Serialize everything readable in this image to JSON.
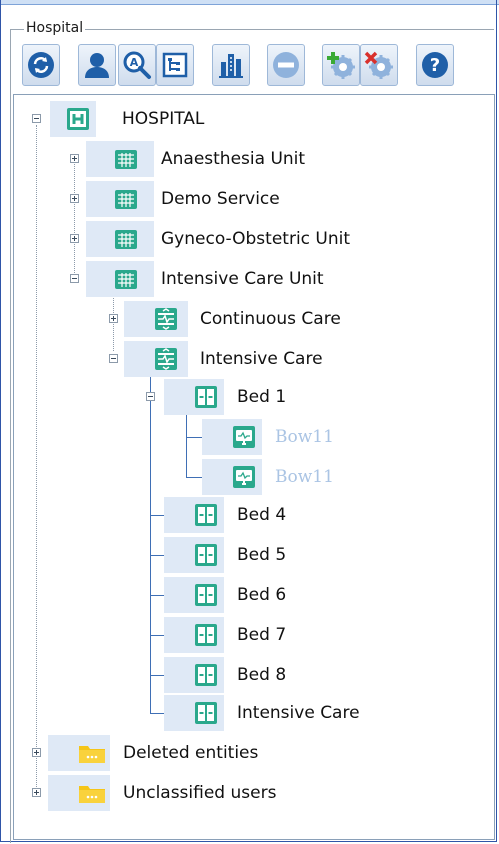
{
  "panel": {
    "title": "Hospital"
  },
  "toolbar": {
    "buttons": [
      {
        "name": "refresh-icon"
      },
      {
        "name": "user-icon"
      },
      {
        "name": "search-icon"
      },
      {
        "name": "hierarchy-icon"
      },
      {
        "name": "building-icon"
      },
      {
        "name": "remove-icon"
      },
      {
        "name": "add-settings-icon"
      },
      {
        "name": "delete-settings-icon"
      },
      {
        "name": "help-icon"
      }
    ]
  },
  "tree": {
    "root": "HOSPITAL",
    "units": {
      "anaesthesia": "Anaesthesia Unit",
      "demo": "Demo Service",
      "gyneco": "Gyneco-Obstetric Unit",
      "icu": "Intensive Care Unit"
    },
    "services": {
      "continuous": "Continuous Care",
      "intensive": "Intensive Care"
    },
    "beds": {
      "bed1": "Bed 1",
      "bed4": "Bed 4",
      "bed5": "Bed 5",
      "bed6": "Bed 6",
      "bed7": "Bed 7",
      "bed8": "Bed 8",
      "intensive": "Intensive Care"
    },
    "devices": {
      "d1": "Bow11",
      "d2": "Bow11"
    },
    "folders": {
      "deleted": "Deleted entities",
      "unclassified": "Unclassified users"
    }
  },
  "colors": {
    "accent_teal": "#2aa88c",
    "folder_yellow": "#f5c518",
    "selection": "#dfe9f6",
    "faded_text": "#aac4e4"
  }
}
